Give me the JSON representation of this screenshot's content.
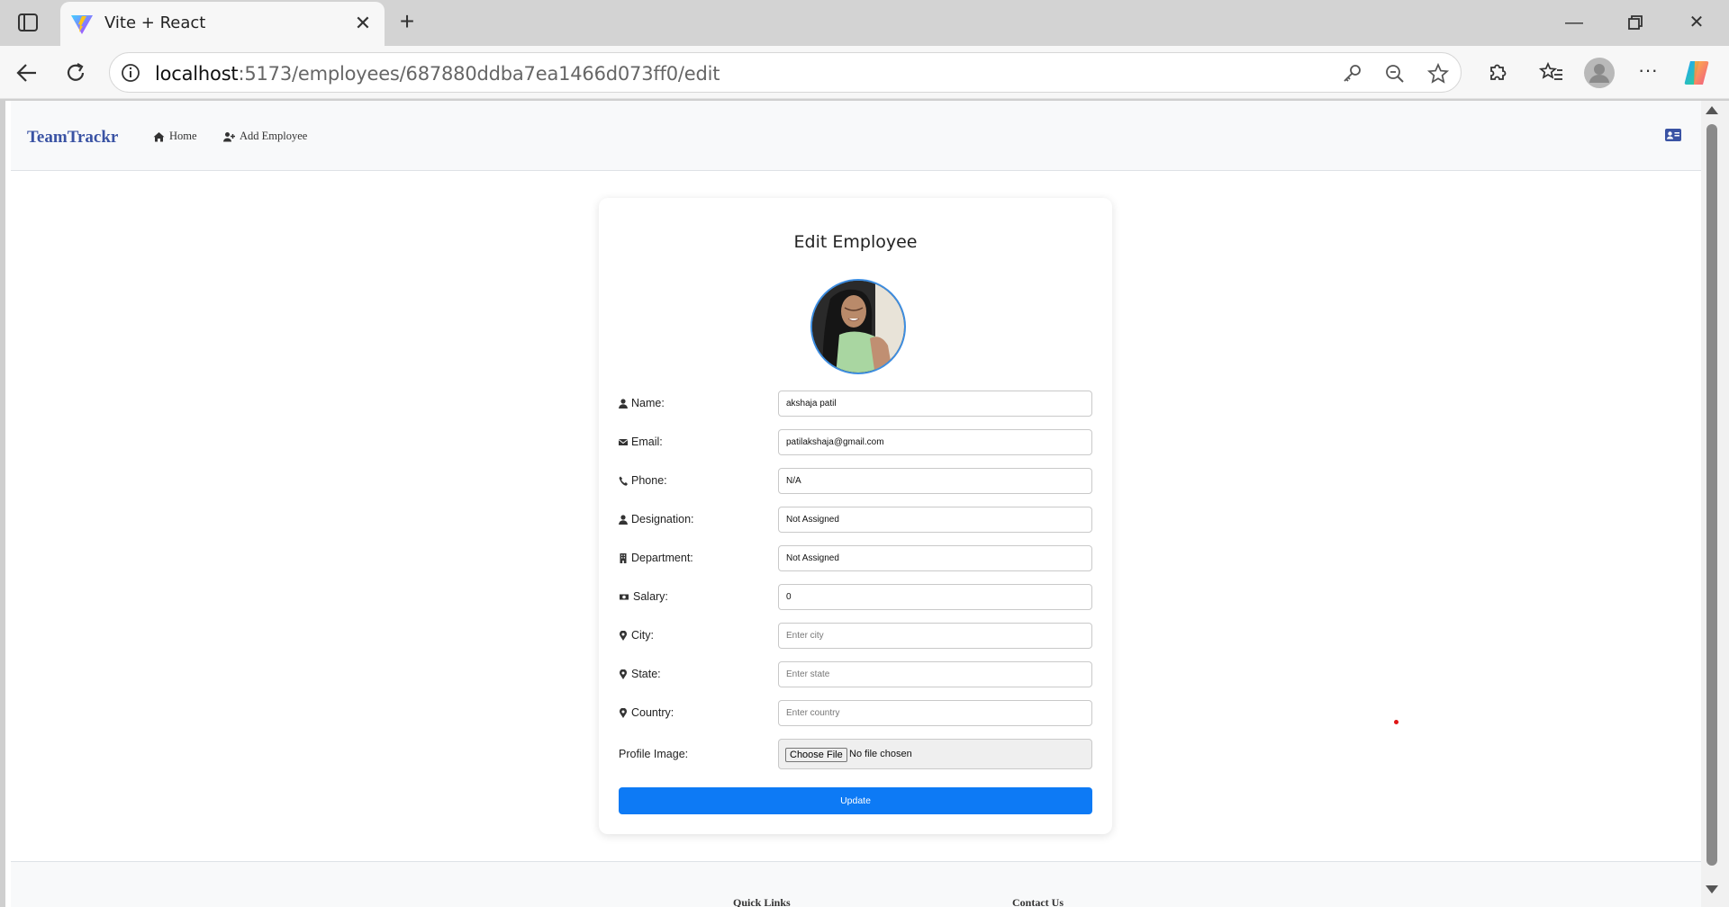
{
  "browser": {
    "tab_title": "Vite + React",
    "url_host": "localhost",
    "url_path": ":5173/employees/687880ddba7ea1466d073ff0/edit"
  },
  "header": {
    "brand": "TeamTrackr",
    "nav": [
      {
        "label": "Home",
        "icon": "home-icon"
      },
      {
        "label": "Add Employee",
        "icon": "user-plus-icon"
      }
    ]
  },
  "form": {
    "title": "Edit Employee",
    "fields": [
      {
        "label": "Name:",
        "value": "akshaja patil",
        "placeholder": "",
        "icon": "user-icon"
      },
      {
        "label": "Email:",
        "value": "patilakshaja@gmail.com",
        "placeholder": "",
        "icon": "envelope-icon"
      },
      {
        "label": "Phone:",
        "value": "N/A",
        "placeholder": "",
        "icon": "phone-icon"
      },
      {
        "label": "Designation:",
        "value": "Not Assigned",
        "placeholder": "",
        "icon": "user-icon"
      },
      {
        "label": "Department:",
        "value": "Not Assigned",
        "placeholder": "",
        "icon": "building-icon"
      },
      {
        "label": "Salary:",
        "value": "0",
        "placeholder": "",
        "icon": "money-icon"
      },
      {
        "label": "City:",
        "value": "",
        "placeholder": "Enter city",
        "icon": "map-pin-icon"
      },
      {
        "label": "State:",
        "value": "",
        "placeholder": "Enter state",
        "icon": "map-pin-icon"
      },
      {
        "label": "Country:",
        "value": "",
        "placeholder": "Enter country",
        "icon": "map-pin-icon"
      }
    ],
    "profile_label": "Profile Image:",
    "choose_file": "Choose File",
    "no_file": "No file chosen",
    "submit": "Update"
  },
  "footer": {
    "quick_links": "Quick Links",
    "contact": "Contact Us"
  },
  "colors": {
    "brand": "#3a53a4",
    "primary": "#0d7af5"
  }
}
